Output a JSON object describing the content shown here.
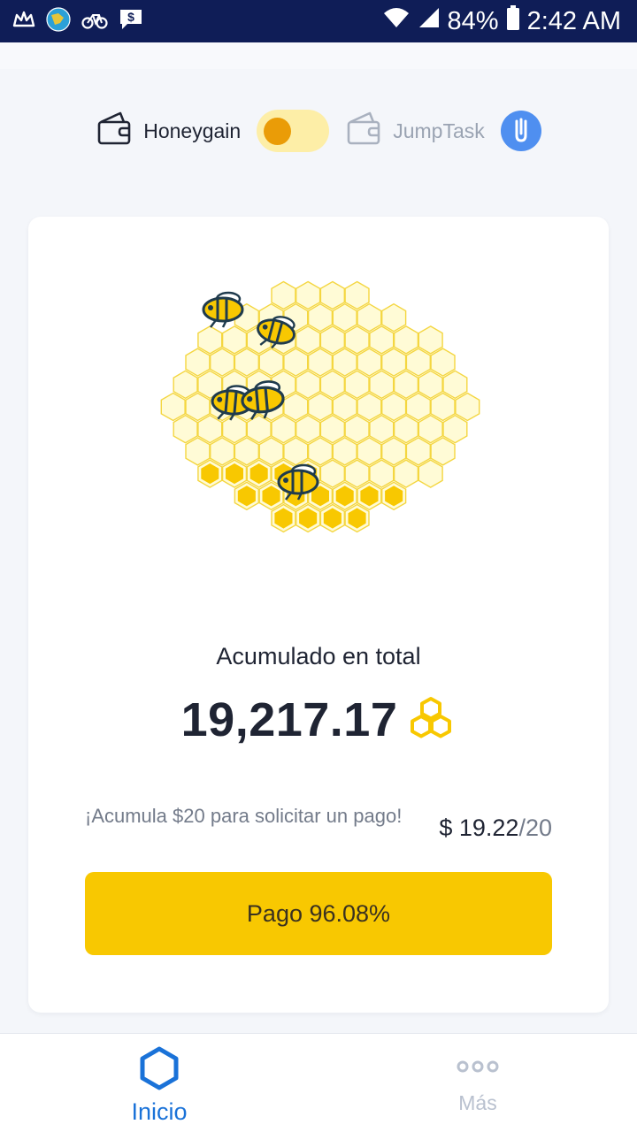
{
  "status_bar": {
    "battery": "84%",
    "time": "2:42 AM",
    "icons": [
      "crown-icon",
      "app-globe-icon",
      "bike-icon",
      "chat-dollar-icon",
      "wifi-icon",
      "signal-icon",
      "battery-icon"
    ]
  },
  "switcher": {
    "honeygain_label": "Honeygain",
    "jumptask_label": "JumpTask",
    "honeygain_icon": "wallet-icon",
    "jumptask_icon": "wallet-icon",
    "jumptask_badge_icon": "jumptask-logo-icon"
  },
  "card": {
    "illustration": "honeycomb-bees",
    "accumulated_label": "Acumulado en total",
    "total_value": "19,217.17",
    "total_icon": "honeycomb-coin-icon",
    "payout_hint": "¡Acumula $20 para solicitar un pago!",
    "payout_current": "$ 19.22",
    "payout_goal": "/20",
    "progress_percent": 96.08,
    "pay_button_label": "Pago 96.08%"
  },
  "bottom_nav": {
    "items": [
      {
        "label": "Inicio",
        "icon": "hexagon-icon",
        "active": true
      },
      {
        "label": "Más",
        "icon": "more-dots-icon",
        "active": false
      }
    ]
  },
  "colors": {
    "status_bar_bg": "#0f1d57",
    "accent_yellow": "#f8c801",
    "toggle_knob": "#ea9c07",
    "toggle_track": "#fdeea7",
    "active_blue": "#1a72d8",
    "jumptask_blue": "#4f8ff0"
  }
}
